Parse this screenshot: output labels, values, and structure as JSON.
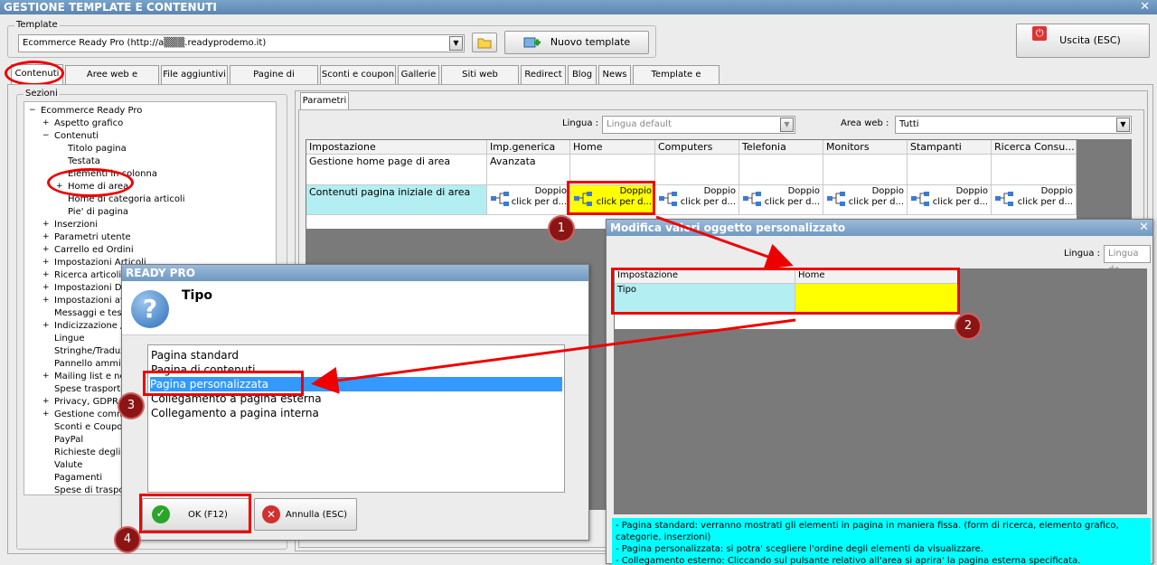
{
  "window": {
    "title": "GESTIONE TEMPLATE E CONTENUTI",
    "close": "✕"
  },
  "template_group": {
    "label": "Template",
    "value": "Ecommerce Ready Pro (http://a▒▒▒.readyprodemo.it)",
    "new_template_label": "Nuovo template"
  },
  "exit_label": "Uscita (ESC)",
  "tabs": [
    "Contenuti",
    "Aree web e categorie",
    "File aggiuntivi",
    "Pagine di contenuti",
    "Sconti e coupon",
    "Gallerie",
    "Siti web collegati",
    "Redirect",
    "Blog",
    "News",
    "Template e plugins"
  ],
  "sections": {
    "label": "Sezioni",
    "tree": [
      {
        "label": "Ecommerce Ready Pro",
        "sign": "−"
      },
      {
        "label": "Aspetto grafico",
        "sign": "+"
      },
      {
        "label": "Contenuti",
        "sign": "−"
      },
      {
        "label": "Titolo pagina",
        "sign": ""
      },
      {
        "label": "Testata",
        "sign": ""
      },
      {
        "label": "Elementi in colonna",
        "sign": ""
      },
      {
        "label": "Home di area",
        "sign": "+"
      },
      {
        "label": "Home di categoria articoli",
        "sign": ""
      },
      {
        "label": "Pie' di pagina",
        "sign": ""
      },
      {
        "label": "Inserzioni",
        "sign": "+"
      },
      {
        "label": "Parametri utente",
        "sign": "+"
      },
      {
        "label": "Carrello ed Ordini",
        "sign": "+"
      },
      {
        "label": "Impostazioni Articoli",
        "sign": "+"
      },
      {
        "label": "Ricerca articoli",
        "sign": "+"
      },
      {
        "label": "Impostazioni Documenti",
        "sign": "+"
      },
      {
        "label": "Impostazioni avanzate",
        "sign": "+"
      },
      {
        "label": "Messaggi e testi vari",
        "sign": ""
      },
      {
        "label": "Indicizzazione / SEO",
        "sign": "+"
      },
      {
        "label": "Lingue",
        "sign": ""
      },
      {
        "label": "Stringhe/Traduzioni",
        "sign": ""
      },
      {
        "label": "Pannello amministrazione",
        "sign": ""
      },
      {
        "label": "Mailing list e notifiche",
        "sign": "+"
      },
      {
        "label": "Spese trasporto/pagamento",
        "sign": ""
      },
      {
        "label": "Privacy, GDPR e cookie",
        "sign": "+"
      },
      {
        "label": "Gestione commenti",
        "sign": "+"
      },
      {
        "label": "Sconti e Coupon",
        "sign": ""
      },
      {
        "label": "PayPal",
        "sign": ""
      },
      {
        "label": "Richieste degli utenti",
        "sign": ""
      },
      {
        "label": "Valute",
        "sign": ""
      },
      {
        "label": "Pagamenti",
        "sign": ""
      },
      {
        "label": "Spese di trasporto",
        "sign": ""
      }
    ]
  },
  "params": {
    "tab": "Parametri",
    "lingua_label": "Lingua :",
    "lingua_value": "Lingua default",
    "area_label": "Area web :",
    "area_value": "Tutti",
    "headers": [
      "Impostazione",
      "Imp.generica",
      "Home",
      "Computers",
      "Telefonia",
      "Monitors",
      "Stampanti",
      "Ricerca Consu..."
    ],
    "row1": {
      "label": "Gestione home page di area",
      "generic": "Avanzata"
    },
    "row2": {
      "label": "Contenuti pagina iniziale di area",
      "cell_line1": "Doppio",
      "cell_line2": "click per d..."
    }
  },
  "modal2": {
    "title": "Modifica valori oggetto personalizzato",
    "lingua_label": "Lingua :",
    "lingua_value": "Lingua de",
    "headers": [
      "Impostazione",
      "Home"
    ],
    "row_label": "Tipo",
    "help": "- Pagina standard: verranno mostrati gli elementi in pagina in maniera fissa. (form di ricerca, elemento grafico, categorie, inserzioni)\n- Pagina personalizzata: si potra' scegliere l'ordine degli elementi da visualizzare.\n- Collegamento esterno: Cliccando sul pulsante relativo all'area si aprira' la pagina esterna specificata."
  },
  "dialog": {
    "title": "READY PRO",
    "heading": "Tipo",
    "options": [
      "Pagina standard",
      "Pagina di contenuti",
      "Pagina personalizzata",
      "Collegamento a pagina esterna",
      "Collegamento a pagina interna"
    ],
    "selected_index": 2,
    "ok_label": "OK (F12)",
    "cancel_label": "Annulla (ESC)"
  },
  "badges": [
    "1",
    "2",
    "3",
    "4"
  ],
  "colors": {
    "highlight_yellow": "#ffff00",
    "cyan": "#b3eef2",
    "selection": "#3399ff",
    "annotation": "#e00000"
  }
}
